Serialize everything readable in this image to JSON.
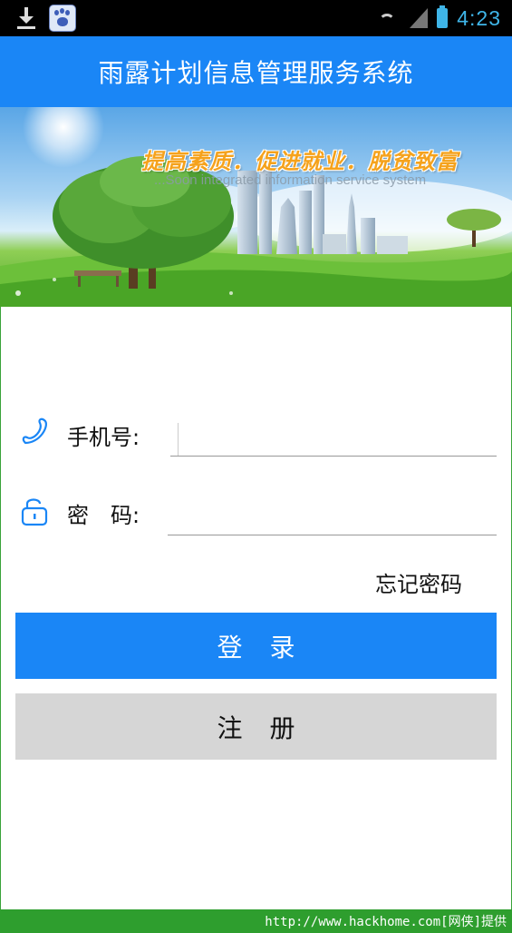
{
  "status_bar": {
    "time": "4:23",
    "icons": [
      "download-icon",
      "baidu-paw-icon",
      "wifi-icon",
      "signal-icon",
      "battery-icon"
    ]
  },
  "header": {
    "title": "雨露计划信息管理服务系统"
  },
  "banner": {
    "slogan": "提高素质．促进就业．脱贫致富",
    "subtitle": "...Soon integrated information service system"
  },
  "form": {
    "phone_label": "手机号:",
    "phone_value": "",
    "phone_placeholder": "",
    "password_label": "密　码:",
    "password_value": "",
    "password_placeholder": ""
  },
  "links": {
    "forgot_password": "忘记密码"
  },
  "buttons": {
    "login": "登录",
    "register": "注册"
  },
  "footer": {
    "watermark": "http://www.hackhome.com[网侠]提供"
  },
  "colors": {
    "primary": "#1a86f6",
    "secondary_button": "#d6d6d6",
    "status_accent": "#3fb5e8",
    "footer_green": "#2e9e2e"
  }
}
